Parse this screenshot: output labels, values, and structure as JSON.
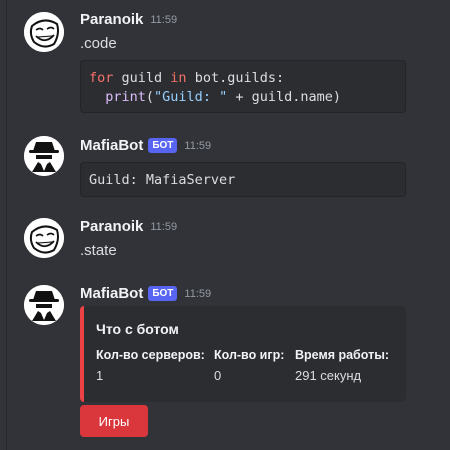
{
  "messages": [
    {
      "author": "Paranoik",
      "time": "11:59",
      "text": ".code",
      "avatar_icon": "troll-face-icon"
    },
    {
      "author": "MafiaBot",
      "badge": "БОТ",
      "time": "11:59",
      "avatar_icon": "mafia-hat-icon"
    },
    {
      "author": "Paranoik",
      "time": "11:59",
      "text": ".state",
      "avatar_icon": "troll-face-icon"
    },
    {
      "author": "MafiaBot",
      "badge": "БОТ",
      "time": "11:59",
      "avatar_icon": "mafia-hat-icon"
    }
  ],
  "code1": {
    "kw_for": "for",
    "var": " guild ",
    "kw_in": "in",
    "iter": " bot.guilds:",
    "indent": "  ",
    "fn_print": "print",
    "open": "(",
    "str": "\"Guild: \"",
    "concat": " + guild.name)"
  },
  "code2": {
    "line": "Guild: MafiaServer"
  },
  "embed": {
    "title": "Что с ботом",
    "fields": [
      {
        "name": "Кол-во серверов:",
        "value": "1"
      },
      {
        "name": "Кол-во игр:",
        "value": "0"
      },
      {
        "name": "Время работы:",
        "value": "291 секунд"
      }
    ],
    "accent_color": "#ed4245"
  },
  "button": {
    "label": "Игры",
    "color": "#da373c"
  },
  "colors": {
    "background": "#313338",
    "bot_badge": "#5865f2"
  }
}
